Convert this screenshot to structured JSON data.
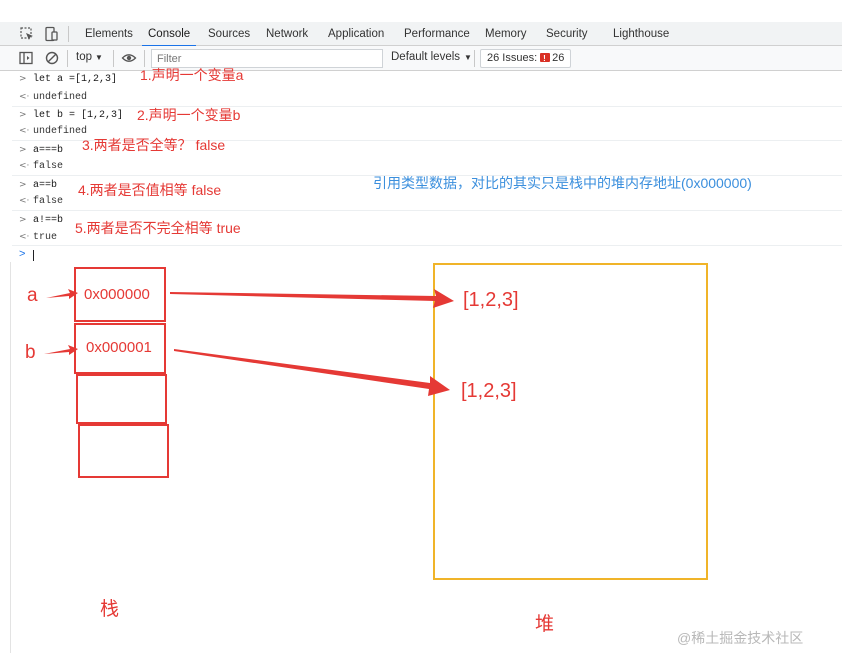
{
  "devtools": {
    "tabs": [
      "Elements",
      "Console",
      "Sources",
      "Network",
      "Application",
      "Performance",
      "Memory",
      "Security",
      "Lighthouse"
    ],
    "active_tab": "Console",
    "icons": [
      "inspect-element-icon",
      "device-toolbar-icon"
    ]
  },
  "toolbar": {
    "context": "top",
    "filter_placeholder": "Filter",
    "levels": "Default levels",
    "issues_label": "26 Issues:",
    "issues_count": "26"
  },
  "console": {
    "rows": [
      {
        "kind": "input",
        "prefix": ">",
        "text": "let a =[1,2,3]"
      },
      {
        "kind": "output",
        "prefix": "<·",
        "text": "undefined"
      },
      {
        "kind": "input",
        "prefix": ">",
        "text": "let b = [1,2,3]"
      },
      {
        "kind": "output",
        "prefix": "<·",
        "text": "undefined"
      },
      {
        "kind": "input",
        "prefix": ">",
        "text": "a===b"
      },
      {
        "kind": "output",
        "prefix": "<·",
        "text": "false"
      },
      {
        "kind": "input",
        "prefix": ">",
        "text": "a==b"
      },
      {
        "kind": "output",
        "prefix": "<·",
        "text": "false"
      },
      {
        "kind": "input",
        "prefix": ">",
        "text": "a!==b"
      },
      {
        "kind": "output",
        "prefix": "<·",
        "text": "true"
      }
    ],
    "prompt": ">"
  },
  "annotations": {
    "note1": "1.声明一个变量a",
    "note2": "2.声明一个变量b",
    "note3": "3.两者是否全等？    false",
    "note4": "4.两者是否值相等   false",
    "note5": "5.两者是否不完全相等 true",
    "summary": "引用类型数据，对比的其实只是栈中的堆内存地址(0x000000)"
  },
  "diagram": {
    "var_a": "a",
    "var_b": "b",
    "addr_a": "0x000000",
    "addr_b": "0x000001",
    "heap_value_1": "[1,2,3]",
    "heap_value_2": "[1,2,3]",
    "stack_label": "栈",
    "heap_label": "堆",
    "colors": {
      "accent": "#e53935",
      "heap_border": "#f0b429",
      "note_blue": "#3b8fdd"
    }
  },
  "watermark": "@稀土掘金技术社区"
}
